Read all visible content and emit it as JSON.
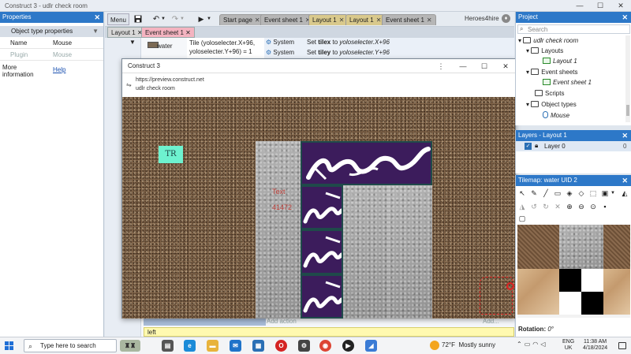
{
  "window": {
    "title": "Construct 3 - udlr check room",
    "minimize": "—",
    "maximize": "☐",
    "close": "✕"
  },
  "properties": {
    "header": "Properties",
    "section": "Object type properties",
    "rows": [
      {
        "key": "Name",
        "value": "Mouse"
      },
      {
        "key": "Plugin",
        "value": "Mouse"
      }
    ],
    "more_info_label": "More information",
    "help_link": "Help"
  },
  "toolbar": {
    "menu": "Menu",
    "tabs": [
      "Start page",
      "Event sheet 1",
      "Layout 1",
      "Layout 1",
      "Event sheet 1"
    ],
    "tab_close": "✕",
    "user": "Heroes4hire"
  },
  "doc_tabs": [
    "Layout 1",
    "Event sheet 1"
  ],
  "events": {
    "object": "water",
    "condition_line1": "Tile (yoloselecter.X+96,",
    "condition_line2": "yoloselecter.Y+96) = 1",
    "rows": [
      {
        "object": "System",
        "action_prefix": "Set",
        "var": "tilex",
        "mid": "to",
        "expr": "yoloselecter.X+96"
      },
      {
        "object": "System",
        "action_prefix": "Set",
        "var": "tiley",
        "mid": "to",
        "expr": "yoloselecter.Y+96"
      }
    ],
    "add_action": "Add action",
    "add_action_short": "Add...",
    "input_value": "left"
  },
  "preview": {
    "title": "Construct 3",
    "url": "https://preview.construct.net",
    "page": "udlr check room",
    "badge": "TR",
    "text_label": "Text",
    "text_value": "41472"
  },
  "project": {
    "header": "Project",
    "search_placeholder": "Search",
    "tree": [
      {
        "label": "udlr check room",
        "level": 0,
        "icon": "folder",
        "italic": true
      },
      {
        "label": "Layouts",
        "level": 1,
        "icon": "folder",
        "italic": false
      },
      {
        "label": "Layout 1",
        "level": 2,
        "icon": "layout",
        "italic": true
      },
      {
        "label": "Event sheets",
        "level": 1,
        "icon": "folder",
        "italic": false
      },
      {
        "label": "Event sheet 1",
        "level": 2,
        "icon": "event",
        "italic": true
      },
      {
        "label": "Scripts",
        "level": 1,
        "icon": "folder",
        "italic": false
      },
      {
        "label": "Object types",
        "level": 1,
        "icon": "folder",
        "italic": false
      },
      {
        "label": "Mouse",
        "level": 2,
        "icon": "mouse",
        "italic": true
      }
    ]
  },
  "layers": {
    "header": "Layers - Layout 1",
    "layer_name": "Layer 0",
    "layer_index": "0"
  },
  "tilemap": {
    "header": "Tilemap: water UID 2",
    "rotation_label": "Rotation:",
    "rotation_value": "0°"
  },
  "taskbar": {
    "search_placeholder": "Type here to search",
    "weather_temp": "72°F",
    "weather_desc": "Mostly sunny",
    "lang_1": "ENG",
    "lang_2": "UK",
    "time": "11:38 AM",
    "date": "4/18/2024"
  }
}
